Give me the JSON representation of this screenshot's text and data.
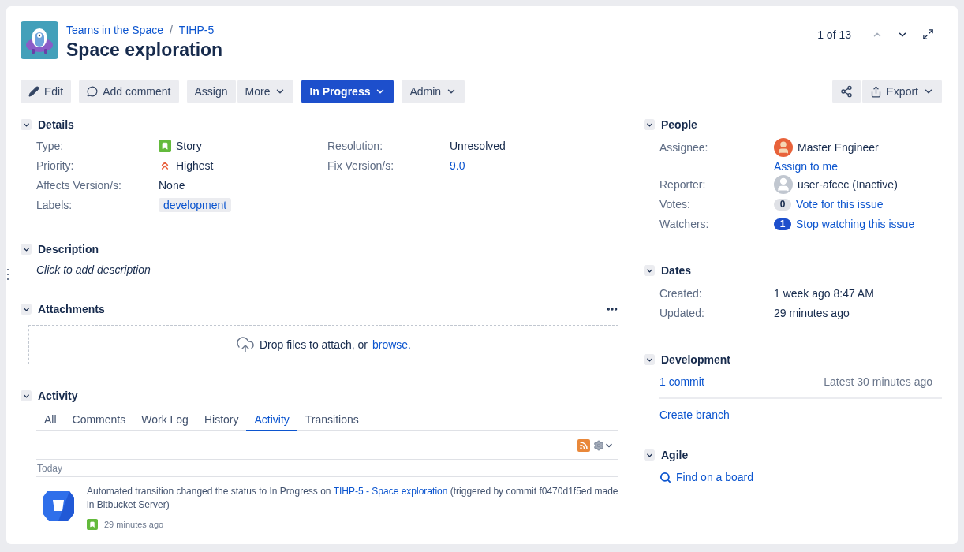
{
  "breadcrumbs": [
    {
      "label": "Teams in the Space"
    },
    {
      "label": "TIHP-5"
    }
  ],
  "breadcrumb_separator": "/",
  "title": "Space exploration",
  "pager": {
    "text": "1 of 13",
    "prev_disabled": true
  },
  "toolbar": [
    [
      {
        "kind": "edit",
        "label": "Edit"
      }
    ],
    [
      {
        "kind": "comment",
        "label": "Add comment"
      }
    ],
    [
      {
        "kind": "plain",
        "label": "Assign"
      },
      {
        "kind": "dropdown",
        "label": "More"
      }
    ],
    [
      {
        "kind": "status",
        "label": "In Progress"
      }
    ],
    [
      {
        "kind": "dropdown",
        "label": "Admin"
      }
    ]
  ],
  "toolbar_right": [
    {
      "kind": "share"
    },
    {
      "kind": "export",
      "label": "Export"
    }
  ],
  "details": {
    "title": "Details",
    "expanded": true,
    "left": [
      {
        "label": "Type:",
        "kind": "type",
        "value": "Story"
      },
      {
        "label": "Priority:",
        "kind": "priority",
        "value": "Highest"
      },
      {
        "label": "Affects Version/s:",
        "kind": "text",
        "value": "None"
      },
      {
        "label": "Labels:",
        "kind": "tag",
        "value": "development"
      }
    ],
    "right": [
      {
        "label": "Resolution:",
        "kind": "text",
        "value": "Unresolved"
      },
      {
        "label": "Fix Version/s:",
        "kind": "link",
        "value": "9.0"
      }
    ]
  },
  "description": {
    "title": "Description",
    "expanded": true,
    "prompt": "Click to add description"
  },
  "attachments": {
    "title": "Attachments",
    "expanded": true,
    "drop_text": "Drop files to attach, or",
    "browse_link": "browse."
  },
  "activity": {
    "title": "Activity",
    "expanded": true,
    "tabs": [
      {
        "label": "All",
        "selected": false
      },
      {
        "label": "Comments",
        "selected": false
      },
      {
        "label": "Work Log",
        "selected": false
      },
      {
        "label": "History",
        "selected": false
      },
      {
        "label": "Activity",
        "selected": true
      },
      {
        "label": "Transitions",
        "selected": false
      }
    ],
    "date_heading": "Today",
    "entries": [
      {
        "text_before": "Automated transition changed the status to In Progress on",
        "link": "TIHP-5 - Space exploration",
        "text_after": "(triggered by commit f0470d1f5ed made in Bitbucket Server)",
        "time": "29 minutes ago"
      }
    ]
  },
  "people": {
    "title": "People",
    "expanded": true,
    "rows": [
      {
        "label": "Assignee:",
        "kind": "assignee",
        "value": "Master Engineer",
        "action": "Assign to me"
      },
      {
        "label": "Reporter:",
        "kind": "reporter",
        "value": "user-afcec (Inactive)"
      },
      {
        "label": "Votes:",
        "kind": "count",
        "count": "0",
        "active": false,
        "value": "Vote for this issue"
      },
      {
        "label": "Watchers:",
        "kind": "count",
        "count": "1",
        "active": true,
        "value": "Stop watching this issue"
      }
    ]
  },
  "dates": {
    "title": "Dates",
    "expanded": true,
    "rows": [
      {
        "label": "Created:",
        "value": "1 week ago 8:47 AM"
      },
      {
        "label": "Updated:",
        "value": "29 minutes ago"
      }
    ]
  },
  "development": {
    "title": "Development",
    "expanded": true,
    "commits_link": "1 commit",
    "latest": "Latest 30 minutes ago",
    "action": "Create branch"
  },
  "agile": {
    "title": "Agile",
    "expanded": true,
    "action": "Find on a board"
  }
}
